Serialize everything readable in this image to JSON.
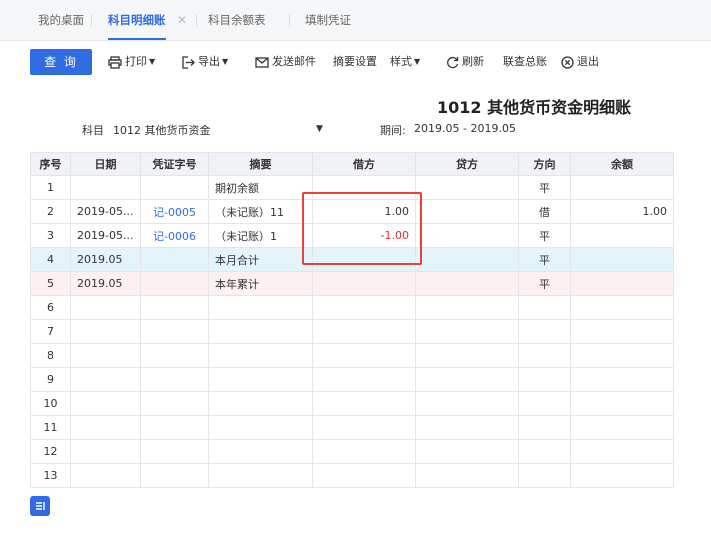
{
  "tabs": [
    {
      "label": "我的桌面",
      "active": false
    },
    {
      "label": "科目明细账",
      "active": true,
      "closable": true
    },
    {
      "label": "科目余额表",
      "active": false
    },
    {
      "label": "填制凭证",
      "active": false
    }
  ],
  "toolbar": {
    "query": "查 询",
    "print": "打印",
    "export": "导出",
    "send_mail": "发送邮件",
    "summary_settings": "摘要设置",
    "style": "样式",
    "refresh": "刷新",
    "link_general": "联查总账",
    "exit": "退出"
  },
  "report": {
    "title": "1012 其他货币资金明细账",
    "subject_label": "科目",
    "subject_value": "1012 其他货币资金",
    "period_label": "期间:",
    "period_value": "2019.05 - 2019.05"
  },
  "table": {
    "headers": [
      "序号",
      "日期",
      "凭证字号",
      "摘要",
      "借方",
      "贷方",
      "方向",
      "余额"
    ],
    "rows": [
      {
        "no": "1",
        "date": "",
        "voucher": "",
        "summary": "期初余额",
        "debit": "",
        "credit": "",
        "direction": "平",
        "balance": ""
      },
      {
        "no": "2",
        "date": "2019-05...",
        "voucher": "记-0005",
        "summary": "（未记账）11",
        "debit": "1.00",
        "credit": "",
        "direction": "借",
        "balance": "1.00"
      },
      {
        "no": "3",
        "date": "2019-05...",
        "voucher": "记-0006",
        "summary": "（未记账）1",
        "debit": "-1.00",
        "credit": "",
        "direction": "平",
        "balance": ""
      },
      {
        "no": "4",
        "date": "2019.05",
        "voucher": "",
        "summary": "本月合计",
        "debit": "",
        "credit": "",
        "direction": "平",
        "balance": ""
      },
      {
        "no": "5",
        "date": "2019.05",
        "voucher": "",
        "summary": "本年累计",
        "debit": "",
        "credit": "",
        "direction": "平",
        "balance": ""
      },
      {
        "no": "6",
        "date": "",
        "voucher": "",
        "summary": "",
        "debit": "",
        "credit": "",
        "direction": "",
        "balance": ""
      },
      {
        "no": "7",
        "date": "",
        "voucher": "",
        "summary": "",
        "debit": "",
        "credit": "",
        "direction": "",
        "balance": ""
      },
      {
        "no": "8",
        "date": "",
        "voucher": "",
        "summary": "",
        "debit": "",
        "credit": "",
        "direction": "",
        "balance": ""
      },
      {
        "no": "9",
        "date": "",
        "voucher": "",
        "summary": "",
        "debit": "",
        "credit": "",
        "direction": "",
        "balance": ""
      },
      {
        "no": "10",
        "date": "",
        "voucher": "",
        "summary": "",
        "debit": "",
        "credit": "",
        "direction": "",
        "balance": ""
      },
      {
        "no": "11",
        "date": "",
        "voucher": "",
        "summary": "",
        "debit": "",
        "credit": "",
        "direction": "",
        "balance": ""
      },
      {
        "no": "12",
        "date": "",
        "voucher": "",
        "summary": "",
        "debit": "",
        "credit": "",
        "direction": "",
        "balance": ""
      },
      {
        "no": "13",
        "date": "",
        "voucher": "",
        "summary": "",
        "debit": "",
        "credit": "",
        "direction": "",
        "balance": ""
      }
    ]
  },
  "colors": {
    "accent": "#2f6ce0",
    "negative": "#e03131",
    "highlight_box": "#e8403a",
    "month_row_bg": "#e3f4fb",
    "year_row_bg": "#fdf0f0"
  },
  "icons": {
    "print": "printer-icon",
    "export": "export-icon",
    "send_mail": "mail-icon",
    "refresh": "refresh-icon",
    "exit": "close-circle-icon",
    "bottom": "column-settings-icon"
  }
}
